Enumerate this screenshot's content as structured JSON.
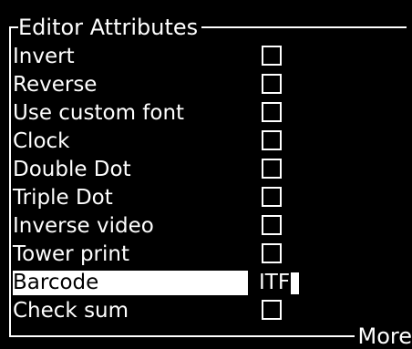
{
  "panel": {
    "title": "Editor Attributes",
    "more_label": "More"
  },
  "rows": [
    {
      "label": "Invert",
      "type": "checkbox",
      "checked": false
    },
    {
      "label": "Reverse",
      "type": "checkbox",
      "checked": false
    },
    {
      "label": "Use custom font",
      "type": "checkbox",
      "checked": false
    },
    {
      "label": "Clock",
      "type": "checkbox",
      "checked": false
    },
    {
      "label": "Double Dot",
      "type": "checkbox",
      "checked": false
    },
    {
      "label": "Triple Dot",
      "type": "checkbox",
      "checked": false
    },
    {
      "label": "Inverse video",
      "type": "checkbox",
      "checked": false
    },
    {
      "label": "Tower print",
      "type": "checkbox",
      "checked": false
    },
    {
      "label": "Barcode",
      "type": "value",
      "value": "ITF",
      "selected": true
    },
    {
      "label": "Check sum",
      "type": "checkbox",
      "checked": false
    }
  ],
  "colors": {
    "background": "#000000",
    "foreground": "#ffffff"
  }
}
